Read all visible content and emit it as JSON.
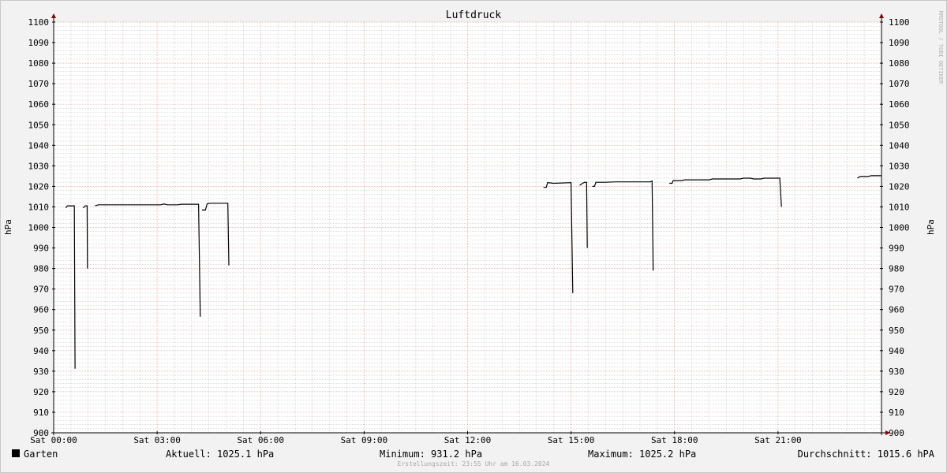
{
  "chart_data": {
    "type": "line",
    "title": "Luftdruck",
    "ylabel": "hPa",
    "watermark": "RRDTOOL / TOBI OETIKER",
    "ylim": [
      900,
      1100
    ],
    "y_ticks": [
      900,
      910,
      920,
      930,
      940,
      950,
      960,
      970,
      980,
      990,
      1000,
      1010,
      1020,
      1030,
      1040,
      1050,
      1060,
      1070,
      1080,
      1090,
      1100
    ],
    "xlim": [
      0,
      24
    ],
    "x_ticks": [
      {
        "x": 0,
        "label": "Sat 00:00"
      },
      {
        "x": 3,
        "label": "Sat 03:00"
      },
      {
        "x": 6,
        "label": "Sat 06:00"
      },
      {
        "x": 9,
        "label": "Sat 09:00"
      },
      {
        "x": 12,
        "label": "Sat 12:00"
      },
      {
        "x": 15,
        "label": "Sat 15:00"
      },
      {
        "x": 18,
        "label": "Sat 18:00"
      },
      {
        "x": 21,
        "label": "Sat 21:00"
      }
    ],
    "grid": true,
    "legend_position": "bottom-left",
    "colors": {
      "line": "#000000",
      "major_grid": "#e8a0a0",
      "minor_grid": "#c8c8c8",
      "axis": "#000000",
      "arrow": "#8b0000",
      "plot_bg": "#ffffff"
    },
    "series": [
      {
        "name": "Garten",
        "segments": [
          [
            [
              0.35,
              1009.5
            ],
            [
              0.4,
              1010.5
            ],
            [
              0.6,
              1010.5
            ],
            [
              0.62,
              931.2
            ]
          ],
          [
            [
              0.85,
              1009.5
            ],
            [
              0.92,
              1010.5
            ],
            [
              0.97,
              1010.5
            ],
            [
              0.98,
              980
            ]
          ],
          [
            [
              1.2,
              1010.5
            ],
            [
              1.3,
              1011
            ],
            [
              3.1,
              1011
            ],
            [
              3.2,
              1011.4
            ],
            [
              3.3,
              1011
            ],
            [
              3.6,
              1011
            ],
            [
              3.7,
              1011.3
            ],
            [
              4.2,
              1011.3
            ],
            [
              4.25,
              956.5
            ]
          ],
          [
            [
              4.3,
              1008.5
            ],
            [
              4.4,
              1008.5
            ],
            [
              4.45,
              1011.5
            ],
            [
              4.55,
              1011.8
            ],
            [
              5.05,
              1011.8
            ],
            [
              5.08,
              981.5
            ]
          ],
          [
            [
              14.2,
              1019.5
            ],
            [
              14.28,
              1019.5
            ],
            [
              14.32,
              1021.8
            ],
            [
              14.5,
              1021.5
            ],
            [
              15.0,
              1021.8
            ],
            [
              15.05,
              968
            ]
          ],
          [
            [
              15.25,
              1020.5
            ],
            [
              15.33,
              1021.5
            ],
            [
              15.4,
              1022
            ],
            [
              15.45,
              1022
            ],
            [
              15.47,
              990
            ]
          ],
          [
            [
              15.62,
              1020
            ],
            [
              15.68,
              1020
            ],
            [
              15.72,
              1022
            ],
            [
              16.0,
              1022
            ],
            [
              16.3,
              1022.2
            ],
            [
              17.3,
              1022.2
            ],
            [
              17.35,
              1022.6
            ],
            [
              17.38,
              979
            ]
          ],
          [
            [
              17.85,
              1021.5
            ],
            [
              17.93,
              1021.5
            ],
            [
              17.96,
              1022.8
            ],
            [
              18.2,
              1022.8
            ],
            [
              18.3,
              1023.2
            ],
            [
              19.0,
              1023.2
            ],
            [
              19.1,
              1023.6
            ],
            [
              19.9,
              1023.6
            ],
            [
              20.0,
              1024
            ],
            [
              20.2,
              1024
            ],
            [
              20.3,
              1023.6
            ],
            [
              20.5,
              1023.6
            ],
            [
              20.6,
              1024
            ],
            [
              21.05,
              1024
            ],
            [
              21.1,
              1010
            ]
          ],
          [
            [
              23.3,
              1024
            ],
            [
              23.38,
              1024.8
            ],
            [
              23.6,
              1024.8
            ],
            [
              23.7,
              1025.2
            ],
            [
              24.0,
              1025.2
            ]
          ]
        ]
      }
    ]
  },
  "footer": {
    "legend_label": "Garten",
    "current": "Aktuell: 1025.1 hPa",
    "minimum": "Minimum: 931.2 hPa",
    "maximum": "Maximum: 1025.2 hPa",
    "average": "Durchschnitt: 1015.6 hPA",
    "created": "Erstellungszeit: 23:55 Uhr am 16.03.2024"
  }
}
